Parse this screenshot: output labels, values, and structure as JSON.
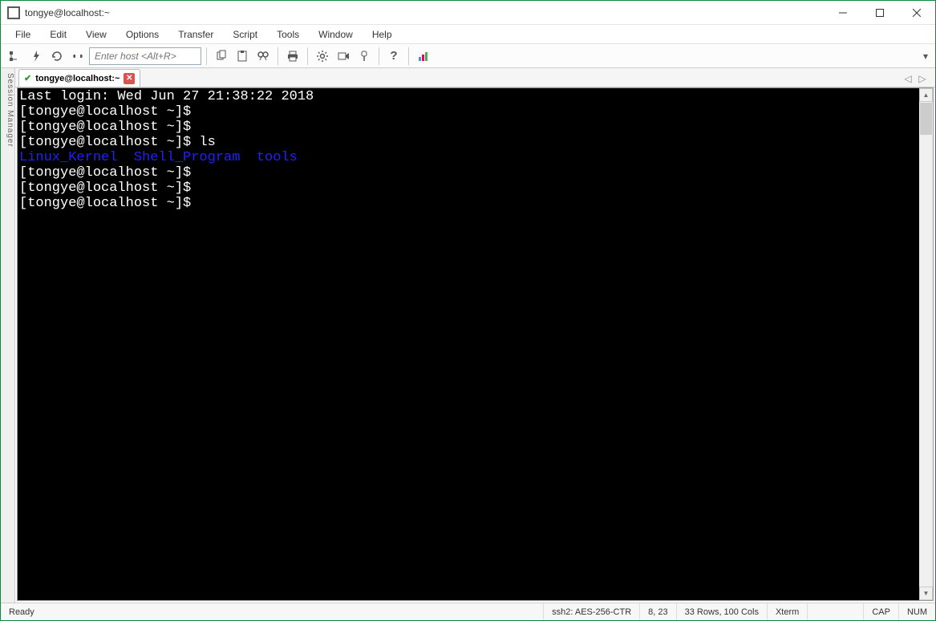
{
  "window": {
    "title": "tongye@localhost:~"
  },
  "menu": {
    "items": [
      "File",
      "Edit",
      "View",
      "Options",
      "Transfer",
      "Script",
      "Tools",
      "Window",
      "Help"
    ]
  },
  "toolbar": {
    "host_placeholder": "Enter host <Alt+R>"
  },
  "sidepanel": {
    "label": "Session Manager"
  },
  "tab": {
    "label": "tongye@localhost:~"
  },
  "terminal": {
    "lines": [
      "Last login: Wed Jun 27 21:38:22 2018",
      "[tongye@localhost ~]$ ",
      "[tongye@localhost ~]$ ",
      "[tongye@localhost ~]$ ls"
    ],
    "ls_output": "Linux_Kernel  Shell_Program  tools",
    "after_lines": [
      "[tongye@localhost ~]$ ",
      "[tongye@localhost ~]$ ",
      "[tongye@localhost ~]$ "
    ]
  },
  "status": {
    "ready": "Ready",
    "protocol": "ssh2: AES-256-CTR",
    "cursor": "8,  23",
    "size": "33 Rows, 100 Cols",
    "term": "Xterm",
    "caps": "CAP",
    "num": "NUM"
  }
}
